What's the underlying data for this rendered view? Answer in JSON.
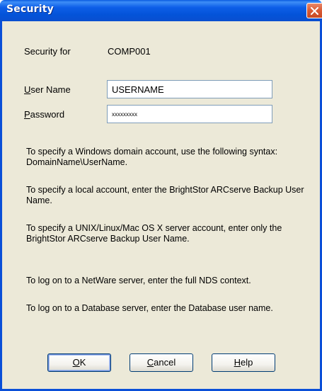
{
  "window": {
    "title": "Security"
  },
  "security_for": {
    "label": "Security for",
    "value": "COMP001"
  },
  "user_name": {
    "label_mnemonic": "U",
    "label_rest": "ser Name",
    "value": "USERNAME"
  },
  "password": {
    "label_mnemonic": "P",
    "label_rest": "assword",
    "value": "xxxxxxxxx"
  },
  "instructions": [
    "To specify a Windows domain account, use the following syntax: DomainName\\UserName.",
    "To specify a local account, enter the BrightStor ARCserve Backup User Name.",
    "To specify a UNIX/Linux/Mac OS X server account, enter only the BrightStor ARCserve Backup User Name.",
    "To log on to a NetWare server, enter the full NDS context.",
    "To log on to a Database server, enter the Database user name."
  ],
  "buttons": {
    "ok": {
      "mnemonic": "O",
      "rest": "K"
    },
    "cancel": {
      "mnemonic": "C",
      "rest": "ancel"
    },
    "help": {
      "mnemonic": "H",
      "rest": "elp"
    }
  },
  "colors": {
    "titlebar": "#0453d8",
    "dialog_bg": "#ece9d8",
    "close_button": "#d95a35"
  }
}
